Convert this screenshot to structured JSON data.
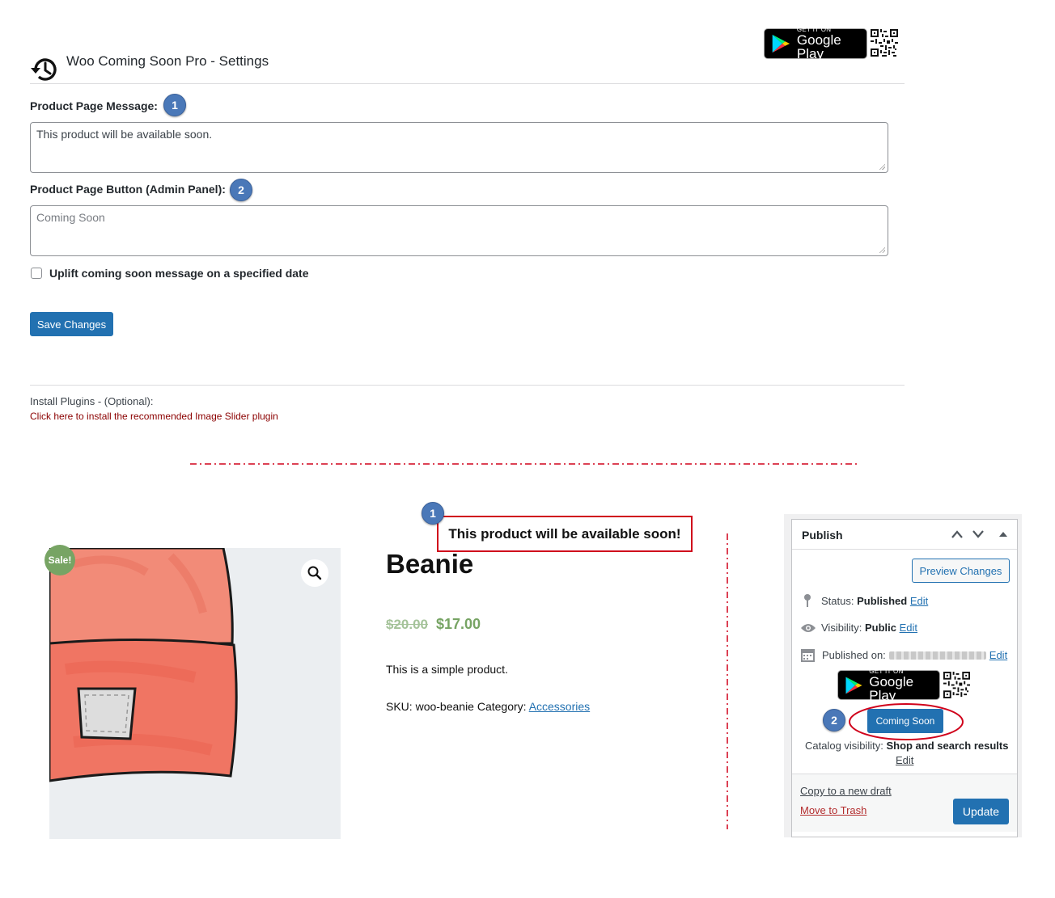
{
  "settings": {
    "title": "Woo Coming Soon Pro - Settings",
    "google_play": {
      "small": "GET IT ON",
      "big": "Google Play"
    },
    "product_page_message": {
      "label": "Product Page Message:",
      "badge": "1",
      "value": "This product will be available soon."
    },
    "product_page_button": {
      "label": "Product Page Button (Admin Panel):",
      "badge": "2",
      "placeholder": "Coming Soon"
    },
    "uplift_checkbox": {
      "label": "Uplift coming soon message on a specified date",
      "checked": false
    },
    "save_button": "Save Changes",
    "install_plugins": {
      "label": "Install Plugins - (Optional):",
      "link": "Click here to install the recommended Image Slider plugin"
    }
  },
  "preview": {
    "notice_badge": "1",
    "notice": "This product will be available soon!",
    "sale_badge": "Sale!",
    "product_title": "Beanie",
    "old_price": "$20.00",
    "new_price": "$17.00",
    "description": "This is a simple product.",
    "sku_label": "SKU:",
    "sku_value": "woo-beanie",
    "category_label": "Category:",
    "category_link": "Accessories"
  },
  "publish": {
    "header": "Publish",
    "preview_button": "Preview Changes",
    "status_label": "Status:",
    "status_value": "Published",
    "visibility_label": "Visibility:",
    "visibility_value": "Public",
    "published_label": "Published on:",
    "edit": "Edit",
    "google_play": {
      "small": "GET IT ON",
      "big": "Google Play"
    },
    "coming_soon_badge": "2",
    "coming_soon_button": "Coming Soon",
    "catalog_label": "Catalog visibility:",
    "catalog_value": "Shop and search results",
    "copy_draft": "Copy to a new draft",
    "move_trash": "Move to Trash",
    "update_button": "Update"
  },
  "colors": {
    "wp_blue": "#2271b1",
    "badge_blue": "#4a78b8",
    "highlight_red": "#d0021b",
    "sale_green": "#77a464"
  }
}
